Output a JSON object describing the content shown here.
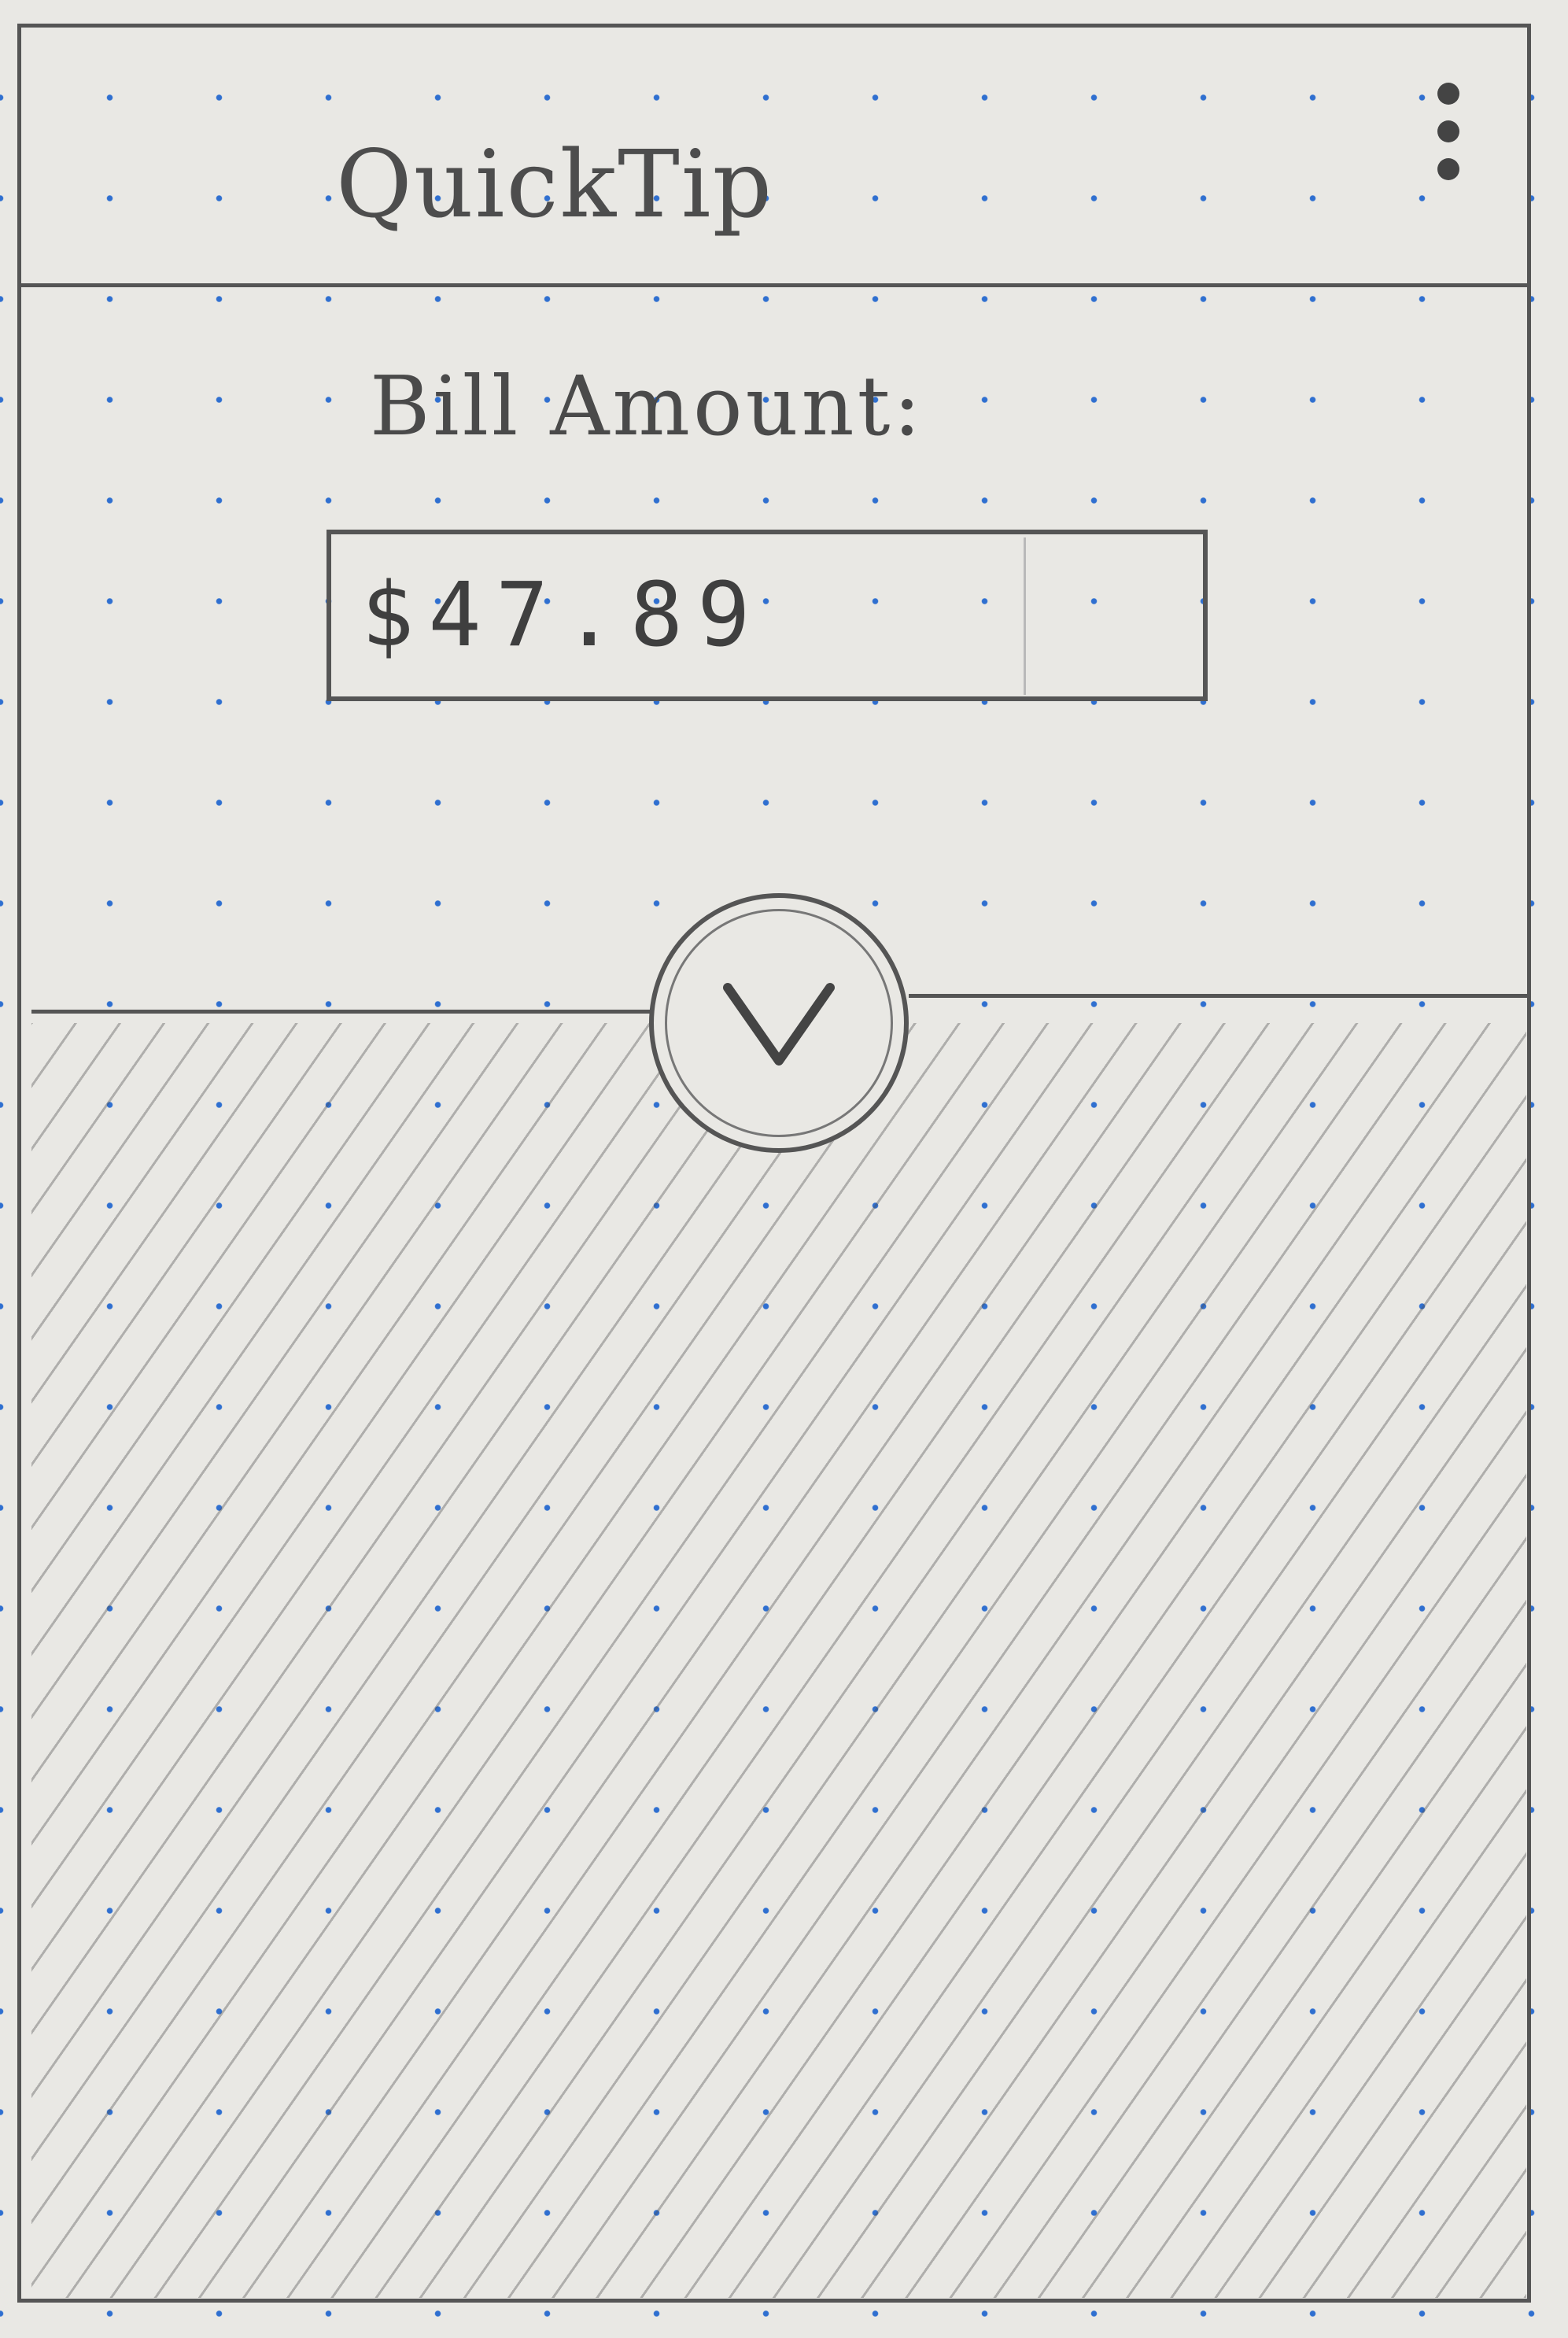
{
  "app_bar": {
    "title": "QuickTip",
    "menu_icon": "overflow-menu-icon"
  },
  "bill": {
    "label": "Bill Amount:",
    "value": "$47.89"
  },
  "toggle": {
    "icon": "chevron-down-icon"
  },
  "colors": {
    "pencil": "#555555",
    "paper": "#e9e8e4",
    "dot": "#2f6fd0"
  }
}
